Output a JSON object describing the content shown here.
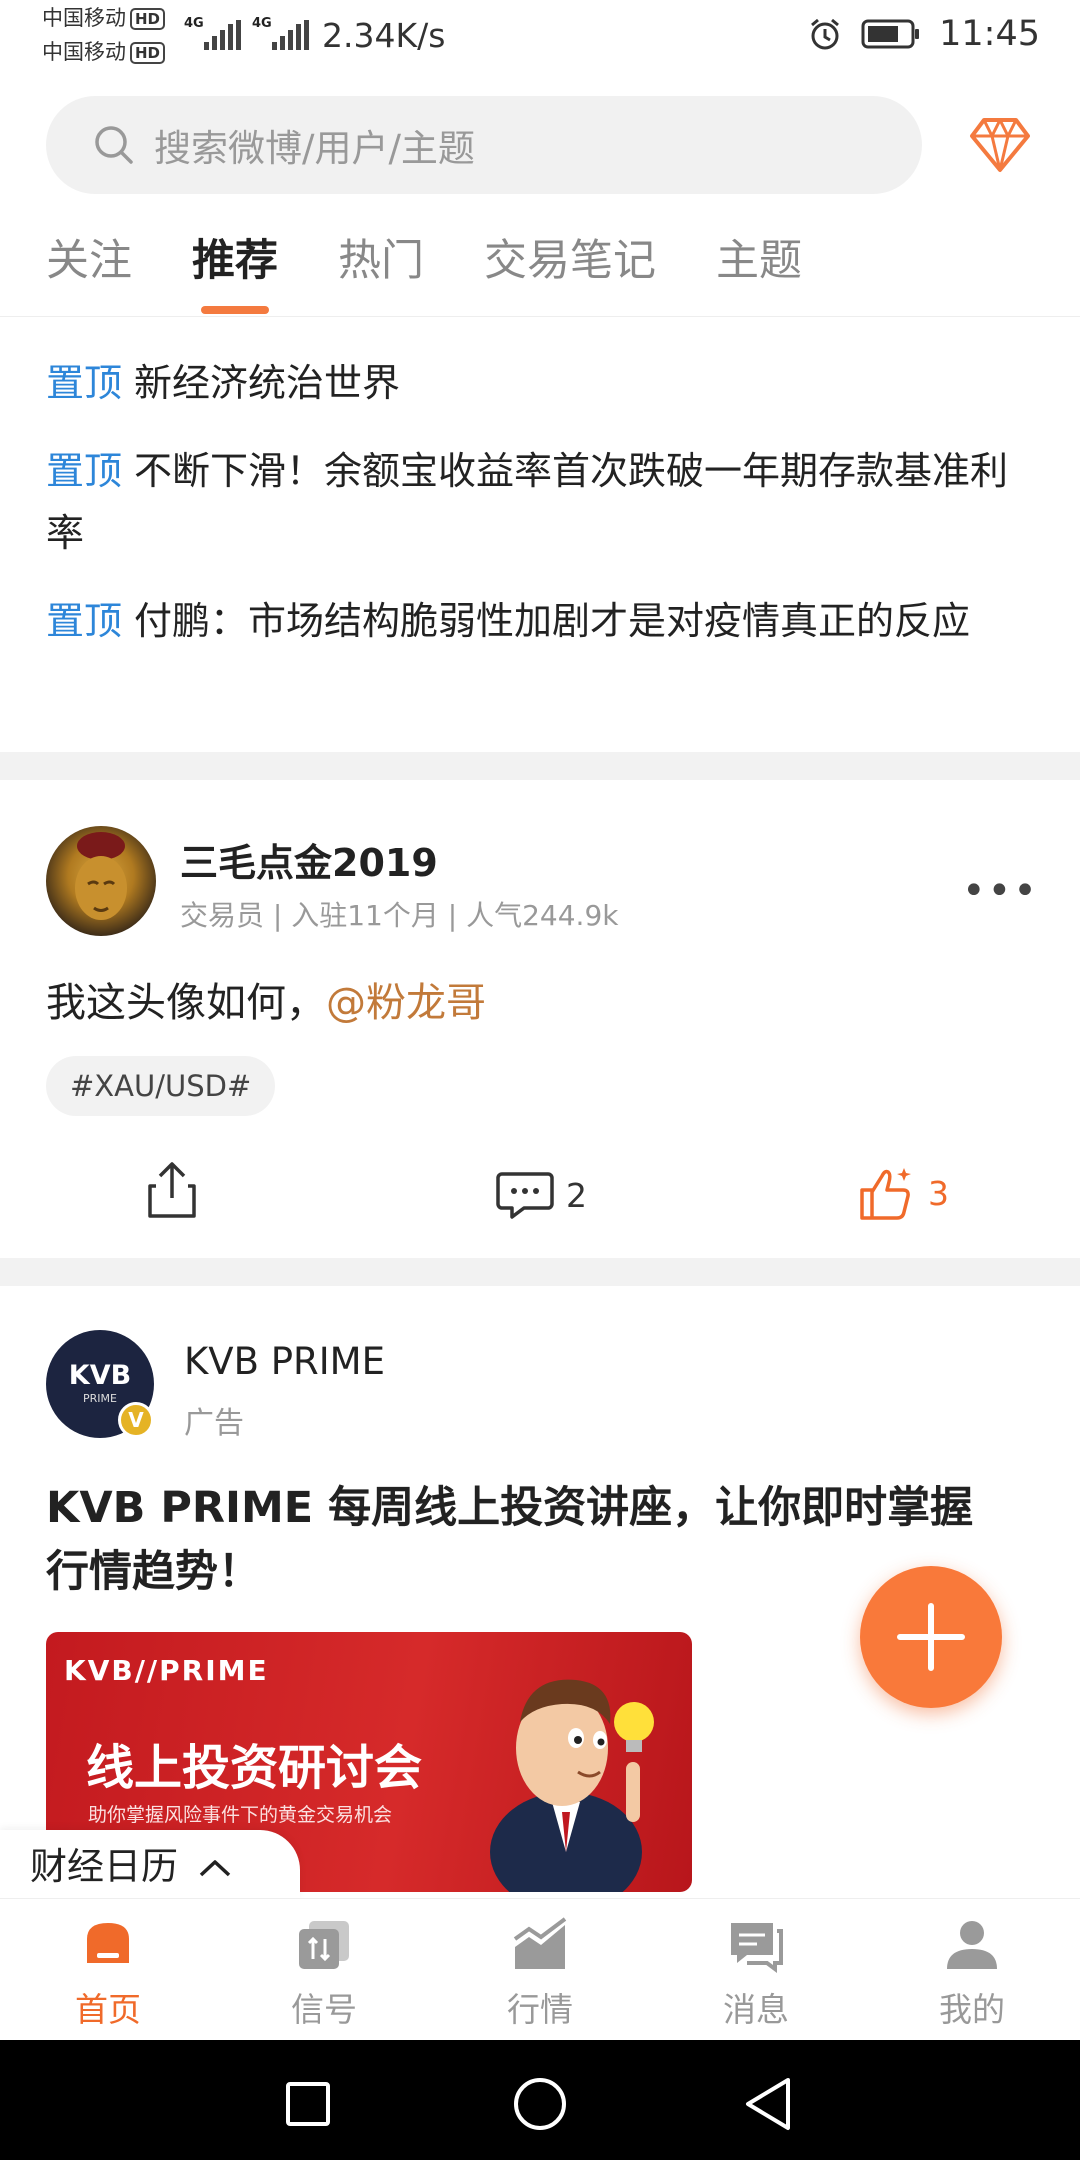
{
  "status_bar": {
    "carrier1": "中国移动",
    "carrier2": "中国移动",
    "hd_badge": "HD",
    "network": "4G",
    "speed": "2.34K/s",
    "time": "11:45"
  },
  "search": {
    "placeholder": "搜索微博/用户/主题"
  },
  "tabs": [
    {
      "label": "关注"
    },
    {
      "label": "推荐"
    },
    {
      "label": "热门"
    },
    {
      "label": "交易笔记"
    },
    {
      "label": "主题"
    }
  ],
  "active_tab": "推荐",
  "pinned": [
    {
      "tag": "置顶",
      "title": "新经济统治世界"
    },
    {
      "tag": "置顶",
      "title": "不断下滑！余额宝收益率首次跌破一年期存款基准利率"
    },
    {
      "tag": "置顶",
      "title": "付鹏：市场结构脆弱性加剧才是对疫情真正的反应"
    }
  ],
  "post": {
    "username": "三毛点金2019",
    "meta": "交易员 | 入驻11个月 | 人气244.9k",
    "text": "我这头像如何，",
    "mention": "@粉龙哥",
    "hashtag": "#XAU/USD#",
    "comment_count": "2",
    "like_count": "3"
  },
  "ad": {
    "brand": "KVB PRIME",
    "avatar_text": "KVB",
    "avatar_sub": "PRIME",
    "verified": "V",
    "label": "广告",
    "title": "KVB PRIME 每周线上投资讲座，让你即时掌握行情趋势！",
    "banner_logo": "KVB//PRIME",
    "banner_title": "线上投资研讨会",
    "banner_subtitle": "助你掌握风险事件下的黄金交易机会"
  },
  "calendar": {
    "label": "财经日历"
  },
  "bottom_nav": [
    {
      "label": "首页",
      "icon": "home-icon"
    },
    {
      "label": "信号",
      "icon": "signal-icon"
    },
    {
      "label": "行情",
      "icon": "market-icon"
    },
    {
      "label": "消息",
      "icon": "message-icon"
    },
    {
      "label": "我的",
      "icon": "profile-icon"
    }
  ],
  "colors": {
    "accent": "#f47a3f",
    "pin_tag": "#2d86d9",
    "mention": "#c27a3a",
    "banner_red": "#c31a1f"
  }
}
